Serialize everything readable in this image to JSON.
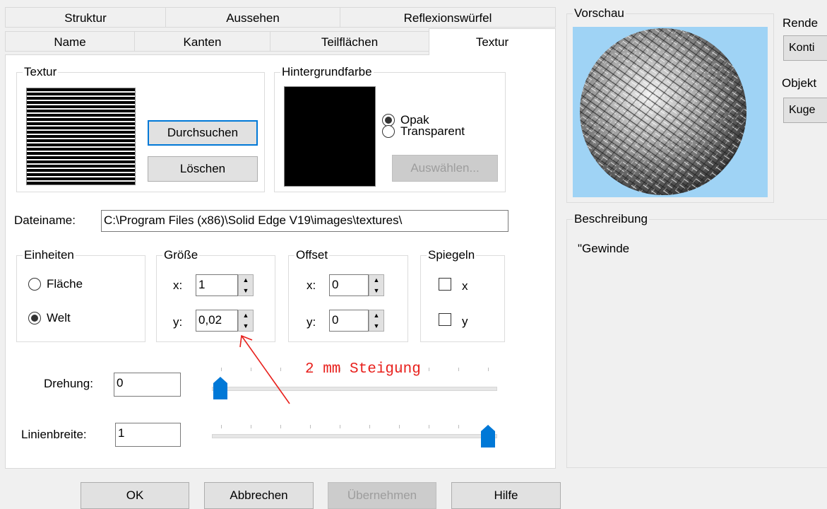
{
  "tabs_row1": [
    "Struktur",
    "Aussehen",
    "Reflexionswürfel"
  ],
  "tabs_row2": [
    "Name",
    "Kanten",
    "Teilflächen",
    "Textur"
  ],
  "texture_group": {
    "legend": "Textur",
    "browse": "Durchsuchen",
    "delete": "Löschen"
  },
  "background_group": {
    "legend": "Hintergrundfarbe",
    "opaque": "Opak",
    "transparent": "Transparent",
    "select": "Auswählen...",
    "opaque_selected": true
  },
  "filename": {
    "label": "Dateiname:",
    "value": "C:\\Program Files (x86)\\Solid Edge V19\\images\\textures\\"
  },
  "units": {
    "legend": "Einheiten",
    "surface": "Fläche",
    "world": "Welt",
    "selected": "Welt"
  },
  "size": {
    "legend": "Größe",
    "x_label": "x:",
    "x_value": "1",
    "y_label": "y:",
    "y_value": "0,02"
  },
  "offset": {
    "legend": "Offset",
    "x_label": "x:",
    "x_value": "0",
    "y_label": "y:",
    "y_value": "0"
  },
  "mirror": {
    "legend": "Spiegeln",
    "x_label": "x",
    "y_label": "y",
    "x_checked": false,
    "y_checked": false
  },
  "rotation": {
    "label": "Drehung:",
    "value": "0",
    "slider_fraction": 0.0
  },
  "linewidth": {
    "label": "Linienbreite:",
    "value": "1",
    "slider_fraction": 1.0
  },
  "annotation": {
    "text": "2 mm Steigung",
    "color": "#e8201c"
  },
  "preview": {
    "legend": "Vorschau",
    "background": "#9fd3f5"
  },
  "render": {
    "label": "Rende",
    "value": "Konti",
    "object_label": "Objekt",
    "object_value": "Kuge"
  },
  "description": {
    "legend": "Beschreibung",
    "text": "\"Gewinde"
  },
  "buttons": {
    "ok": "OK",
    "cancel": "Abbrechen",
    "apply": "Übernehmen",
    "help": "Hilfe"
  },
  "colors": {
    "accent": "#0078d7"
  }
}
